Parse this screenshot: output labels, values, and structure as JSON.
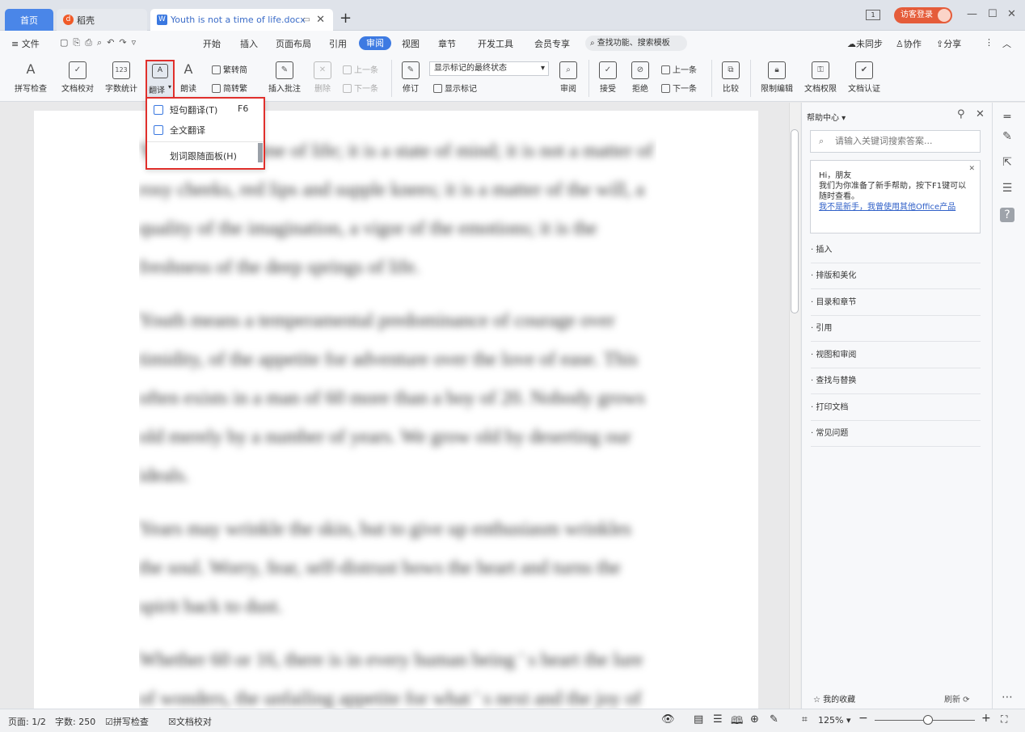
{
  "tabs": {
    "home": "首页",
    "daoke": "稻壳",
    "doc": "Youth is not a time of life.docx"
  },
  "window": {
    "guest_login": "访客登录"
  },
  "menu": {
    "file": "文件",
    "items": [
      "开始",
      "插入",
      "页面布局",
      "引用",
      "审阅",
      "视图",
      "章节",
      "开发工具",
      "会员专享"
    ],
    "search": "查找功能、搜索模板",
    "unsynced": "未同步",
    "collab": "协作",
    "share": "分享"
  },
  "ribbon": {
    "spell": "拼写检查",
    "proof": "文档校对",
    "wordcount": "字数统计",
    "translate": "翻译",
    "read": "朗读",
    "trad_to_simp": "繁转简",
    "simp_to_trad": "简转繁",
    "insert_comment": "插入批注",
    "delete": "删除",
    "prev": "上一条",
    "next": "下一条",
    "revise": "修订",
    "markup_state": "显示标记的最终状态",
    "show_markup": "显示标记",
    "review": "审阅",
    "accept": "接受",
    "reject": "拒绝",
    "prev2": "上一条",
    "next2": "下一条",
    "compare": "比较",
    "restrict": "限制编辑",
    "perm": "文档权限",
    "cert": "文档认证"
  },
  "translate_menu": {
    "short": "短句翻译(T)",
    "short_key": "F6",
    "full": "全文翻译",
    "panel": "划词跟随面板(H)"
  },
  "help": {
    "title": "帮助中心",
    "search_placeholder": "请输入关键词搜索答案...",
    "greet_title": "Hi，朋友",
    "greet_text": "我们为你准备了新手帮助，按下F1键可以随时查看。",
    "greet_link": "我不是新手，我曾使用其他Office产品",
    "items": [
      "插入",
      "排版和美化",
      "目录和章节",
      "引用",
      "视图和审阅",
      "查找与替换",
      "打印文档",
      "常见问题"
    ],
    "favorites": "我的收藏",
    "refresh": "刷新"
  },
  "status": {
    "page": "页面: 1/2",
    "words": "字数: 250",
    "spell": "拼写检查",
    "proof": "文档校对",
    "zoom": "125%"
  },
  "document": {
    "paragraphs": [
      [
        "Youth is not a time of life; it is a state of mind; it is not a matter of",
        "rosy cheeks, red lips and supple knees; it is a matter of the will, a",
        "quality of the imagination, a vigor of the emotions; it is the",
        "freshness of the deep springs of life."
      ],
      [
        "Youth means a temperamental predominance of courage over",
        "timidity, of the appetite for adventure over the love of ease. This",
        "often exists in a man of 60 more than a boy of 20. Nobody grows",
        "old merely by a number of years. We grow old by deserting our",
        "ideals."
      ],
      [
        "Years may wrinkle the skin, but to give up enthusiasm wrinkles",
        "the soul. Worry, fear, self-distrust bows the heart and turns the",
        "spirit back to dust."
      ],
      [
        "Whether 60 or 16, there is in every human being ' s heart the lure",
        "of wonders, the unfailing appetite for what ' s next and the joy of"
      ]
    ]
  }
}
